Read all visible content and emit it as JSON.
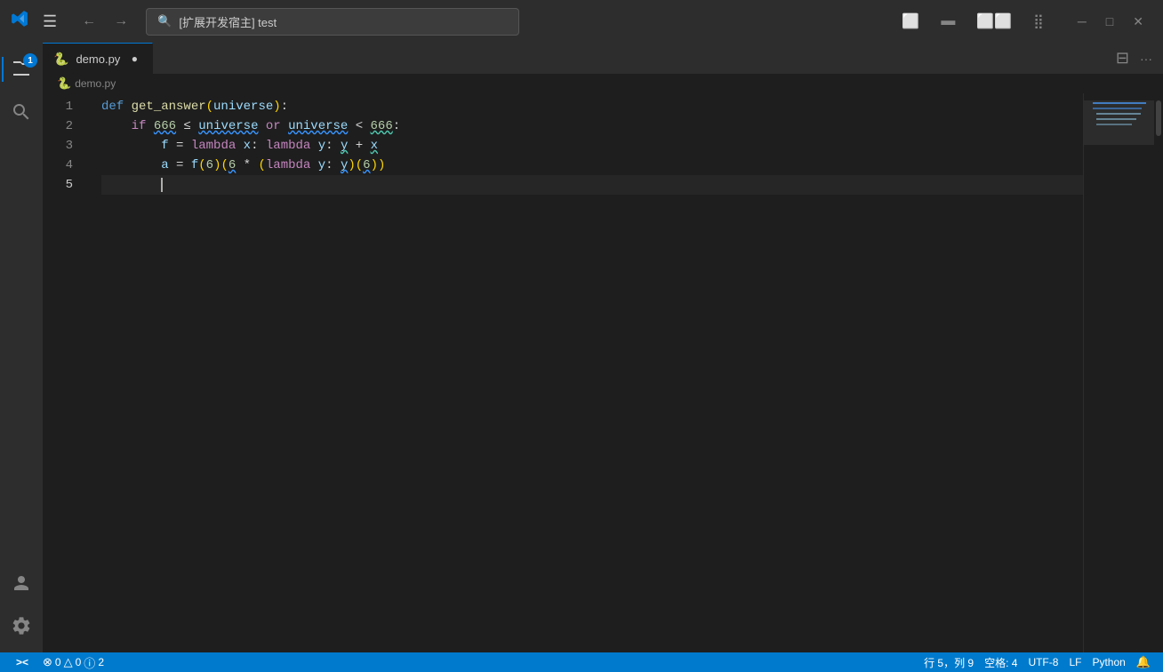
{
  "titlebar": {
    "logo": "VS",
    "menu_icon": "☰",
    "back": "←",
    "forward": "→",
    "search_text": "[扩展开发宿主] test",
    "layout1": "⬜",
    "layout2": "⬛",
    "layout3": "⬜⬜",
    "layout4": "⣿",
    "minimize": "─",
    "maximize": "□",
    "close": "✕"
  },
  "activity_bar": {
    "explorer_badge": "1",
    "icons": [
      "files",
      "search",
      "account",
      "settings"
    ]
  },
  "tab": {
    "icon": "🐍",
    "label": "demo.py",
    "modified": "●",
    "split_icon": "⊟",
    "more_icon": "···"
  },
  "breadcrumb": {
    "icon": "🐍",
    "path": "demo.py"
  },
  "code": {
    "lines": [
      {
        "num": "1",
        "content": "def get_answer(universe):"
      },
      {
        "num": "2",
        "content": "    if 666 ≤ universe or universe < 666:"
      },
      {
        "num": "3",
        "content": "        f = lambda x: lambda y: y + x"
      },
      {
        "num": "4",
        "content": "        a = f(6)(6 * (lambda y: y)(6))"
      },
      {
        "num": "5",
        "content": ""
      }
    ]
  },
  "status_bar": {
    "remote_icon": "><",
    "error_icon": "⊗",
    "errors": "0",
    "warning_icon": "△",
    "warnings": "0",
    "info_icon": "ⓘ",
    "infos": "2",
    "position": "行 5，列 9",
    "spaces": "空格: 4",
    "encoding": "UTF-8",
    "line_ending": "LF",
    "language": "Python",
    "bell_icon": "🔔"
  }
}
